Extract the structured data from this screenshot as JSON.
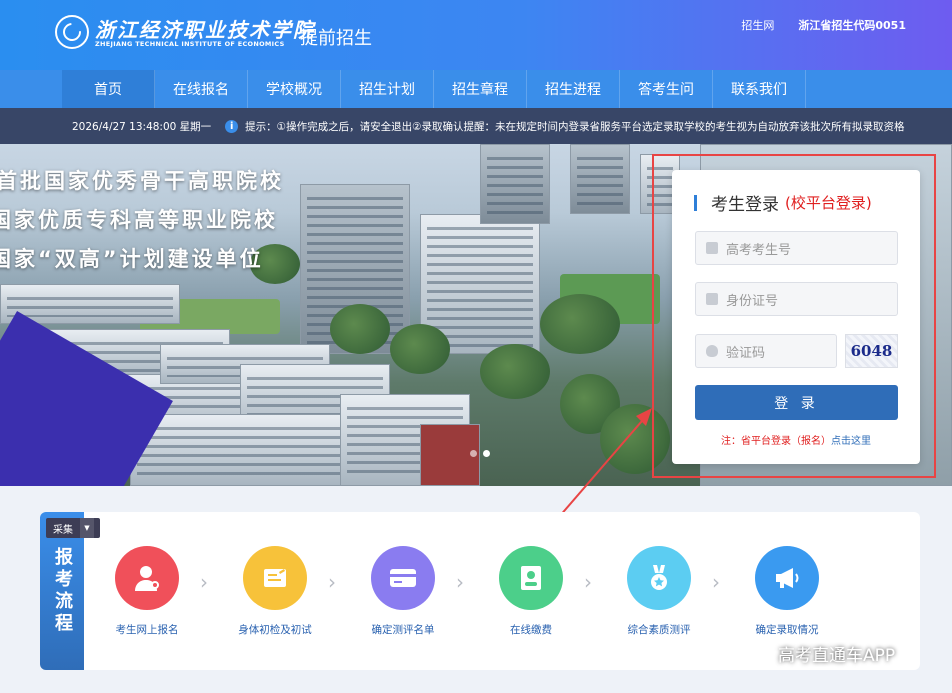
{
  "header": {
    "school_cn": "浙江经济职业技术学院",
    "school_en": "ZHEJIANG TECHNICAL INSTITUTE OF ECONOMICS",
    "subtitle": "提前招生",
    "links": [
      "招生网",
      "浙江省招生代码0051"
    ]
  },
  "nav": {
    "items": [
      "首页",
      "在线报名",
      "学校概况",
      "招生计划",
      "招生章程",
      "招生进程",
      "答考生问",
      "联系我们"
    ]
  },
  "notice": {
    "datetime": "2026/4/27 13:48:00 星期一",
    "text": "提示：①操作完成之后，请安全退出②录取确认提醒：未在规定时间内登录省服务平台选定录取学校的考生视为自动放弃该批次所有拟录取资格"
  },
  "hero": {
    "slogans": [
      "首批国家优秀骨干高职院校",
      "国家优质专科高等职业院校",
      "国家“双高”计划建设单位"
    ]
  },
  "login": {
    "title": "考生登录",
    "title_note": "(校平台登录)",
    "exam_no_placeholder": "高考考生号",
    "id_placeholder": "身份证号",
    "captcha_placeholder": "验证码",
    "captcha_code": "6048",
    "button": "登 录",
    "note_prefix": "注：省平台登录（报名）",
    "note_link": "点击这里"
  },
  "process": {
    "label": "报考流程",
    "collect_tag": "采集",
    "steps": [
      {
        "label": "考生网上报名",
        "color": "#f0505a",
        "icon": "user-doctor-icon"
      },
      {
        "label": "身体初检及初试",
        "color": "#f7c23a",
        "icon": "form-edit-icon"
      },
      {
        "label": "确定测评名单",
        "color": "#8a7cf0",
        "icon": "card-icon"
      },
      {
        "label": "在线缴费",
        "color": "#4ccf8a",
        "icon": "id-document-icon"
      },
      {
        "label": "综合素质测评",
        "color": "#5ccdf2",
        "icon": "medal-icon"
      },
      {
        "label": "确定录取情况",
        "color": "#3a9af0",
        "icon": "megaphone-icon"
      }
    ]
  },
  "watermark": "高考直通车APP"
}
